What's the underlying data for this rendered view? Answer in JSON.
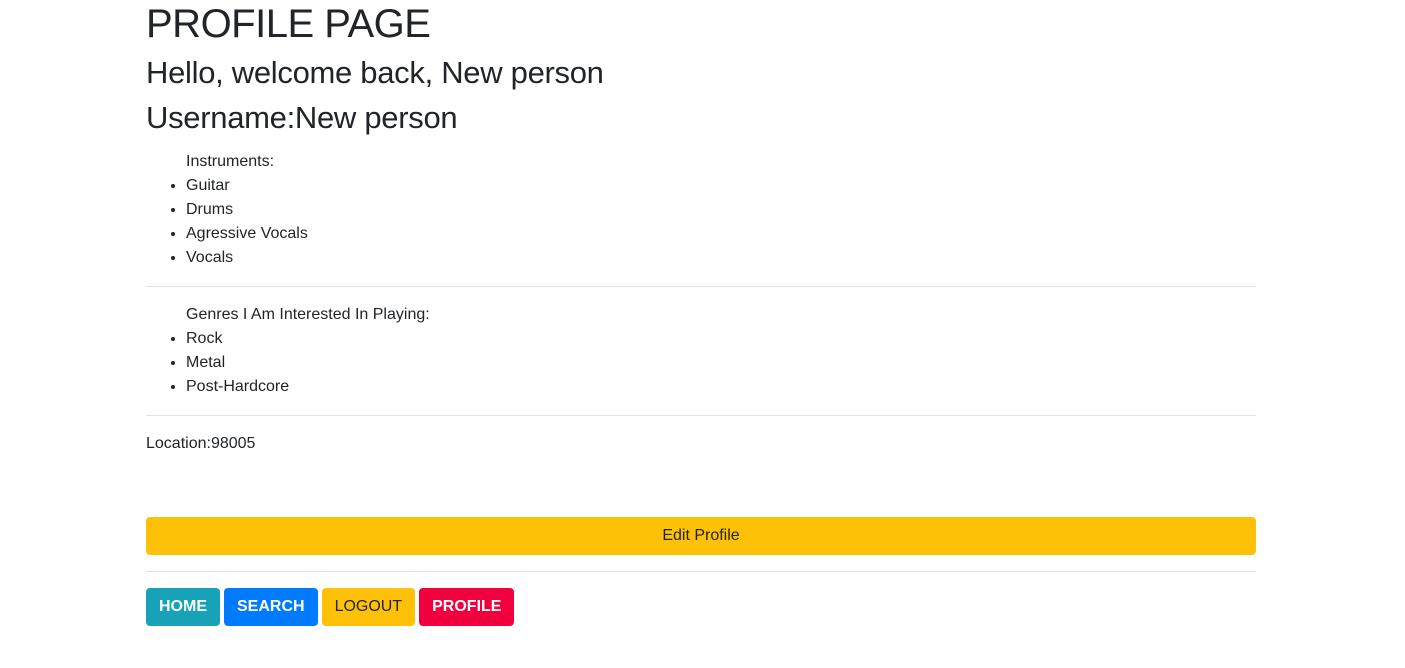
{
  "header": {
    "title": "PROFILE PAGE",
    "welcome": "Hello, welcome back, New person",
    "username": "Username:New person"
  },
  "instruments": {
    "label": "Instruments:",
    "items": [
      "Guitar",
      "Drums",
      "Agressive Vocals",
      "Vocals"
    ]
  },
  "genres": {
    "label": "Genres I Am Interested In Playing:",
    "items": [
      "Rock",
      "Metal",
      "Post-Hardcore"
    ]
  },
  "location": "Location:98005",
  "actions": {
    "edit_label": "Edit Profile"
  },
  "nav": {
    "home": "HOME",
    "search": "SEARCH",
    "logout": "LOGOUT",
    "profile": "PROFILE"
  },
  "colors": {
    "warning": "#ffc107",
    "info": "#17a2b8",
    "primary": "#007bff",
    "danger": "#f0003c",
    "text": "#212529"
  }
}
